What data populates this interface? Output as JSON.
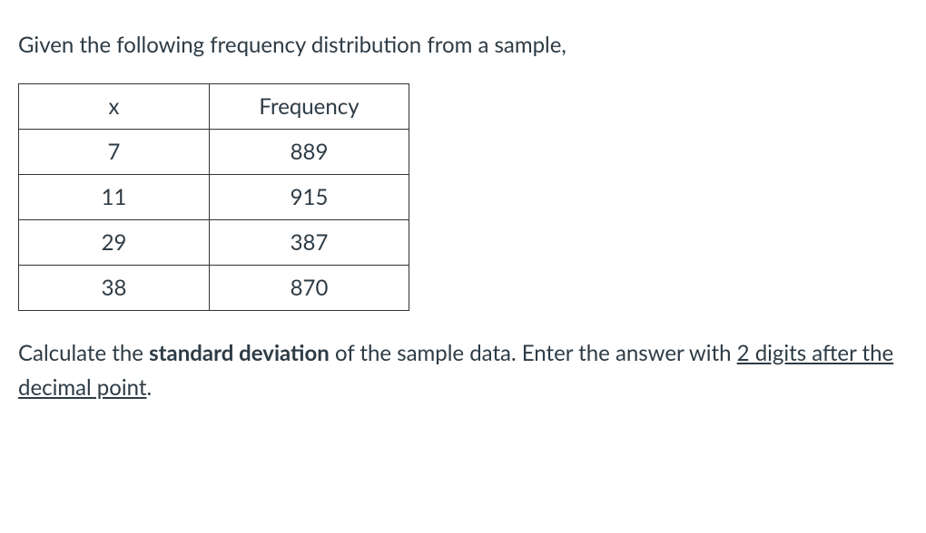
{
  "intro": "Given the following frequency distribution from a sample,",
  "table": {
    "headers": {
      "x": "x",
      "frequency": "Frequency"
    },
    "rows": [
      {
        "x": "7",
        "frequency": "889"
      },
      {
        "x": "11",
        "frequency": "915"
      },
      {
        "x": "29",
        "frequency": "387"
      },
      {
        "x": "38",
        "frequency": "870"
      }
    ]
  },
  "question": {
    "part1": "Calculate the ",
    "bold": "standard deviation",
    "part2": " of the sample data. Enter the answer with ",
    "underline": "2 digits after the decimal point",
    "part3": "."
  }
}
